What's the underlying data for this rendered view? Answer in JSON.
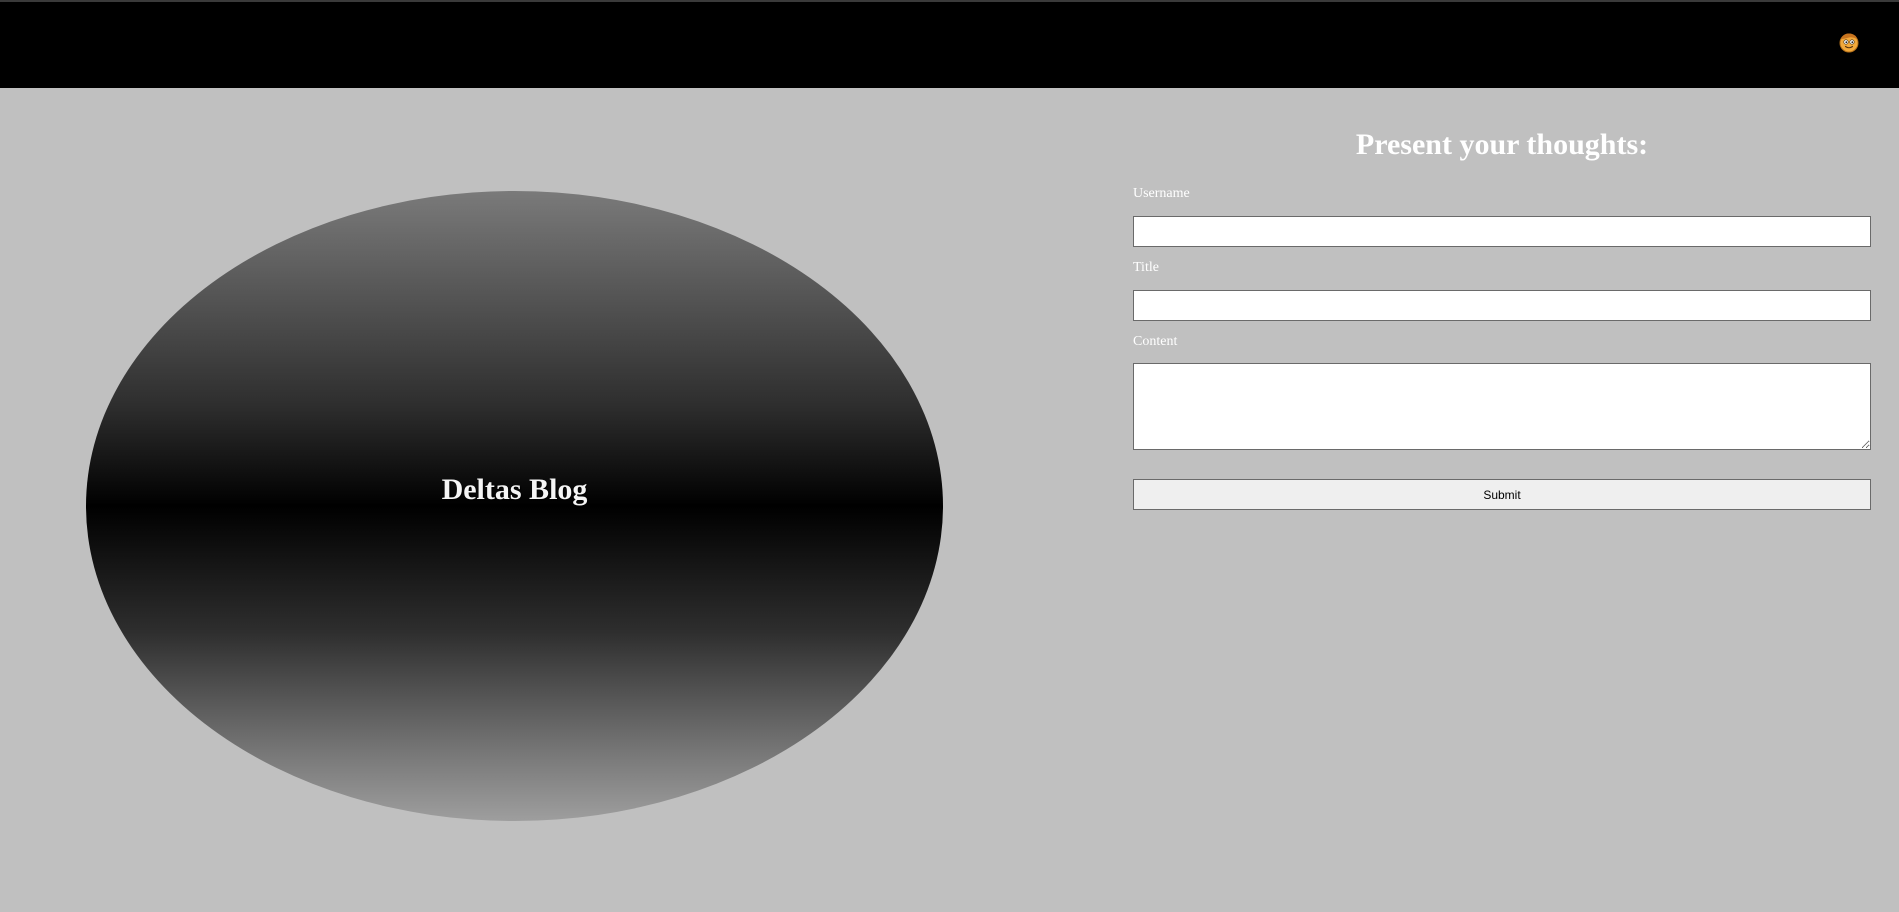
{
  "header": {
    "avatar_icon": "smiley-face-avatar-icon"
  },
  "hero": {
    "title": "Deltas Blog"
  },
  "form": {
    "heading": "Present your thoughts:",
    "username_label": "Username",
    "username_value": "",
    "title_label": "Title",
    "title_value": "",
    "content_label": "Content",
    "content_value": "",
    "submit_label": "Submit"
  },
  "colors": {
    "page_background": "#c0c0c0",
    "navbar_background": "#000000",
    "heading_text": "#ffffff",
    "avatar_face": "#f2a93b"
  }
}
